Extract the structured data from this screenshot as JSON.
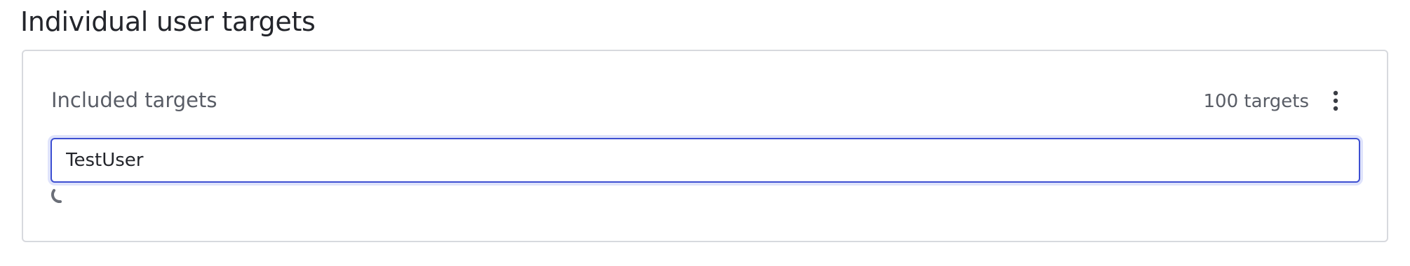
{
  "page": {
    "title": "Individual user targets"
  },
  "included_targets": {
    "label": "Included targets",
    "count_text": "100 targets",
    "menu_icon": "more-vertical-icon",
    "loading_icon": "loading-spinner-icon"
  },
  "search": {
    "value": "TestUser",
    "placeholder": ""
  },
  "colors": {
    "accent": "#3d4fd1",
    "text_primary": "#23252b",
    "text_secondary": "#595d66",
    "border": "#d7d9de"
  }
}
